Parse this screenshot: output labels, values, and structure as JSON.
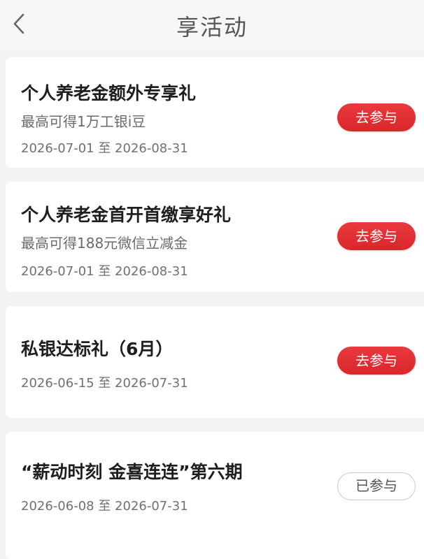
{
  "header": {
    "title": "享活动",
    "back_icon": "chevron-left-icon"
  },
  "colors": {
    "accent": "#e0282e",
    "background": "#f3f3f5"
  },
  "activities": [
    {
      "title": "个人养老金额外专享礼",
      "subtitle": "最高可得1万工银i豆",
      "date_range": "2026-07-01 至 2026-08-31",
      "action_label": "去参与",
      "status": "active"
    },
    {
      "title": "个人养老金首开首缴享好礼",
      "subtitle": "最高可得188元微信立减金",
      "date_range": "2026-07-01 至 2026-08-31",
      "action_label": "去参与",
      "status": "active"
    },
    {
      "title": "私银达标礼（6月）",
      "subtitle": "",
      "date_range": "2026-06-15 至 2026-07-31",
      "action_label": "去参与",
      "status": "active"
    },
    {
      "title": "“薪动时刻 金喜连连”第六期",
      "subtitle": "",
      "date_range": "2026-06-08 至 2026-07-31",
      "action_label": "已参与",
      "status": "done"
    }
  ]
}
